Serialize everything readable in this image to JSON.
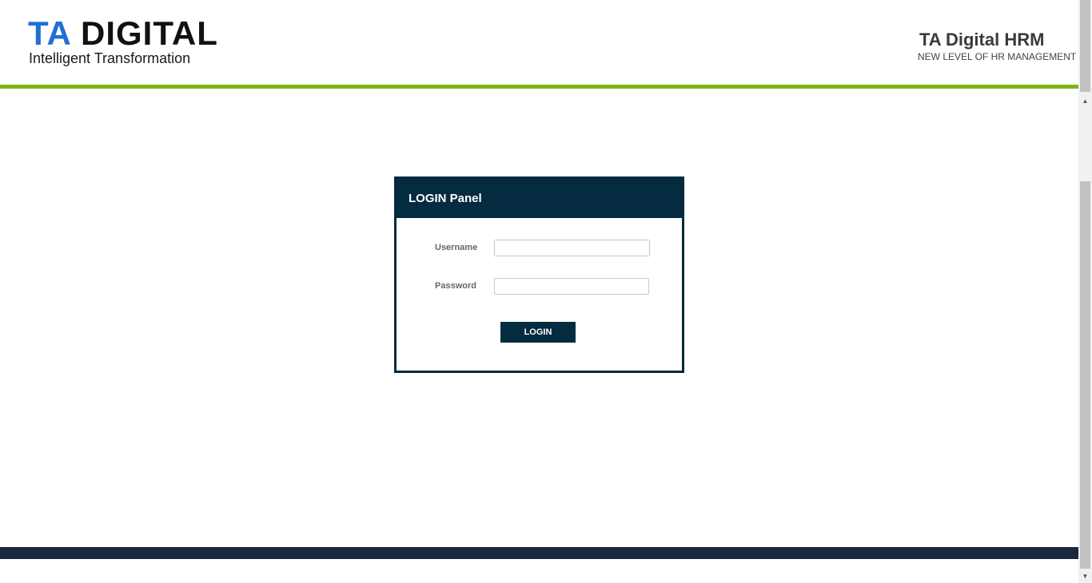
{
  "header": {
    "logo": {
      "word_part1": "TA",
      "word_part2": "DIGITAL",
      "tagline": "Intelligent Transformation",
      "color_ta": "#1f6fd6",
      "color_digital": "#111111"
    },
    "brand_title": "TA Digital HRM",
    "brand_subtitle": "NEW LEVEL OF HR MANAGEMENT"
  },
  "accent_colors": {
    "green_bar": "#7fb21a",
    "panel_navy": "#052b40",
    "footer_navy": "#18283f"
  },
  "login_panel": {
    "title": "LOGIN Panel",
    "username_label": "Username",
    "username_value": "",
    "password_label": "Password",
    "password_value": "",
    "login_button": "LOGIN"
  },
  "scrollbar": {
    "up_icon": "scroll-up-arrow",
    "down_icon": "scroll-down-arrow"
  }
}
